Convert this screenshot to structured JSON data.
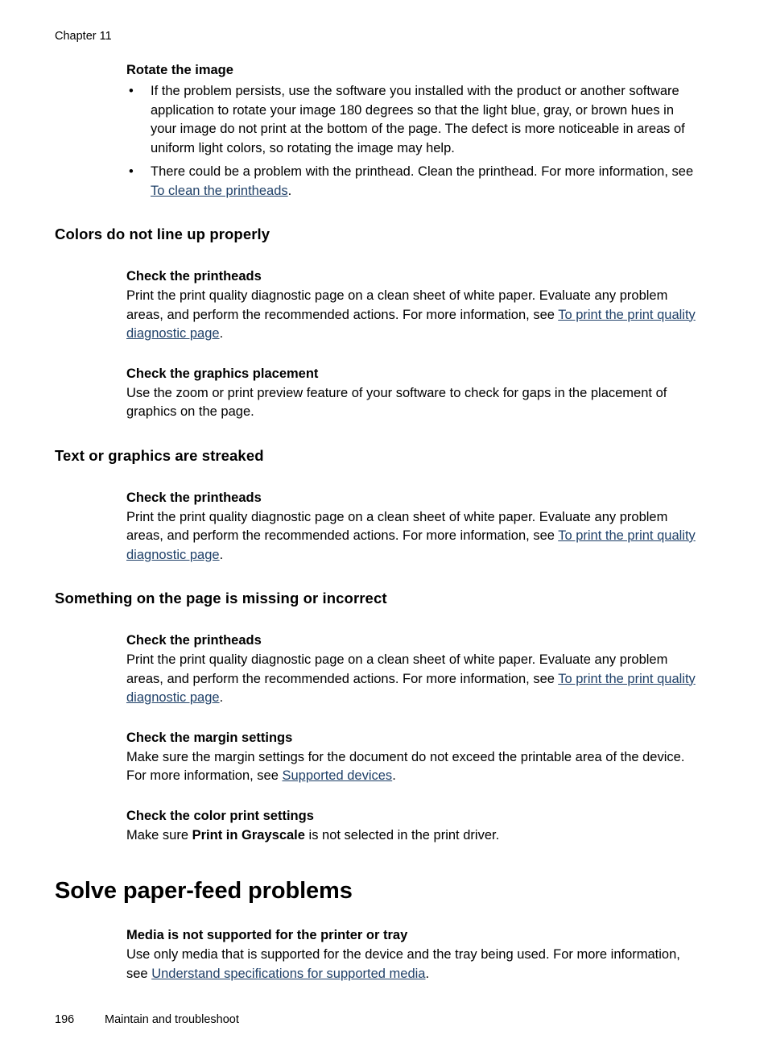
{
  "page": {
    "running_header": "Chapter 11",
    "footer_page_number": "196",
    "footer_text": "Maintain and troubleshoot",
    "link_color": "#1f4068"
  },
  "sections": {
    "rotate_image": {
      "heading": "Rotate the image",
      "bullet_marker": "•",
      "bullets": [
        {
          "text": "If the problem persists, use the software you installed with the product or another software application to rotate your image 180 degrees so that the light blue, gray, or brown hues in your image do not print at the bottom of the page. The defect is more noticeable in areas of uniform light colors, so rotating the image may help."
        },
        {
          "pre": "There could be a problem with the printhead. Clean the printhead. For more information, see ",
          "link": "To clean the printheads",
          "post": "."
        }
      ]
    },
    "colors_not_line_up": {
      "heading": "Colors do not line up properly",
      "sub": [
        {
          "heading": "Check the printheads",
          "pre": "Print the print quality diagnostic page on a clean sheet of white paper. Evaluate any problem areas, and perform the recommended actions. For more information, see ",
          "link": "To print the print quality diagnostic page",
          "post": "."
        },
        {
          "heading": "Check the graphics placement",
          "pre": "Use the zoom or print preview feature of your software to check for gaps in the placement of graphics on the page.",
          "link": "",
          "post": ""
        }
      ]
    },
    "text_graphics_streaked": {
      "heading": "Text or graphics are streaked",
      "sub": [
        {
          "heading": "Check the printheads",
          "pre": "Print the print quality diagnostic page on a clean sheet of white paper. Evaluate any problem areas, and perform the recommended actions. For more information, see ",
          "link": "To print the print quality diagnostic page",
          "post": "."
        }
      ]
    },
    "something_missing": {
      "heading": "Something on the page is missing or incorrect",
      "sub": [
        {
          "heading": "Check the printheads",
          "pre": "Print the print quality diagnostic page on a clean sheet of white paper. Evaluate any problem areas, and perform the recommended actions. For more information, see ",
          "link": "To print the print quality diagnostic page",
          "post": "."
        },
        {
          "heading": "Check the margin settings",
          "pre": "Make sure the margin settings for the document do not exceed the printable area of the device. For more information, see ",
          "link": "Supported devices",
          "post": "."
        },
        {
          "heading": "Check the color print settings",
          "pre": "Make sure ",
          "bold": "Print in Grayscale",
          "post": " is not selected in the print driver."
        }
      ]
    },
    "solve_paper_feed": {
      "heading": "Solve paper-feed problems",
      "sub": [
        {
          "heading": "Media is not supported for the printer or tray",
          "pre": "Use only media that is supported for the device and the tray being used. For more information, see ",
          "link": "Understand specifications for supported media",
          "post": "."
        }
      ]
    }
  }
}
